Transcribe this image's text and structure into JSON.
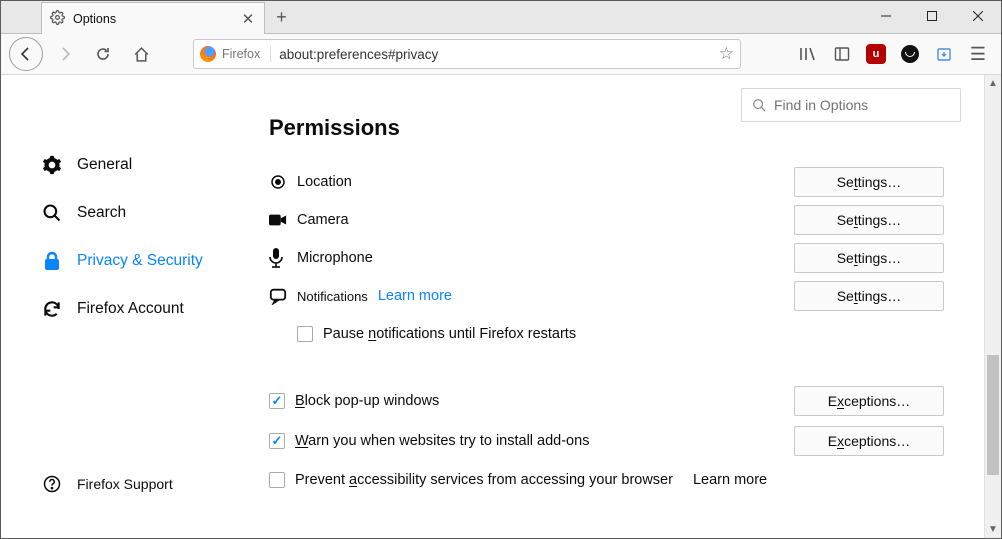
{
  "tab": {
    "title": "Options"
  },
  "url": {
    "brand": "Firefox",
    "value": "about:preferences#privacy"
  },
  "search": {
    "placeholder": "Find in Options"
  },
  "sidebar": {
    "items": [
      {
        "label": "General"
      },
      {
        "label": "Search"
      },
      {
        "label": "Privacy & Security"
      },
      {
        "label": "Firefox Account"
      }
    ],
    "support": "Firefox Support"
  },
  "section": {
    "title": "Permissions"
  },
  "permissions": {
    "location": {
      "label": "Location",
      "button": "Settings…"
    },
    "camera": {
      "label": "Camera",
      "button": "Settings…"
    },
    "microphone": {
      "label": "Microphone",
      "button": "Settings…"
    },
    "notifications": {
      "label": "Notifications",
      "learn": "Learn more",
      "button": "Settings…",
      "pause": "Pause notifications until Firefox restarts"
    }
  },
  "popups": {
    "label_pre": "B",
    "label_post": "lock pop-up windows",
    "button": "Exceptions…"
  },
  "addons": {
    "label_pre": "W",
    "label_post": "arn you when websites try to install add-ons",
    "button": "Exceptions…"
  },
  "a11y": {
    "label_pre": "Prevent ",
    "label_mid": "a",
    "label_post": "ccessibility services from accessing your browser",
    "learn": "Learn more"
  },
  "pause_underline": {
    "pre": "Pause ",
    "u": "n",
    "post": "otifications until Firefox restarts"
  },
  "settings_underline": {
    "pre": "Se",
    "u": "t",
    "post": "tings…"
  },
  "exceptions_underline": {
    "pre": "E",
    "u": "x",
    "post": "ceptions…"
  }
}
